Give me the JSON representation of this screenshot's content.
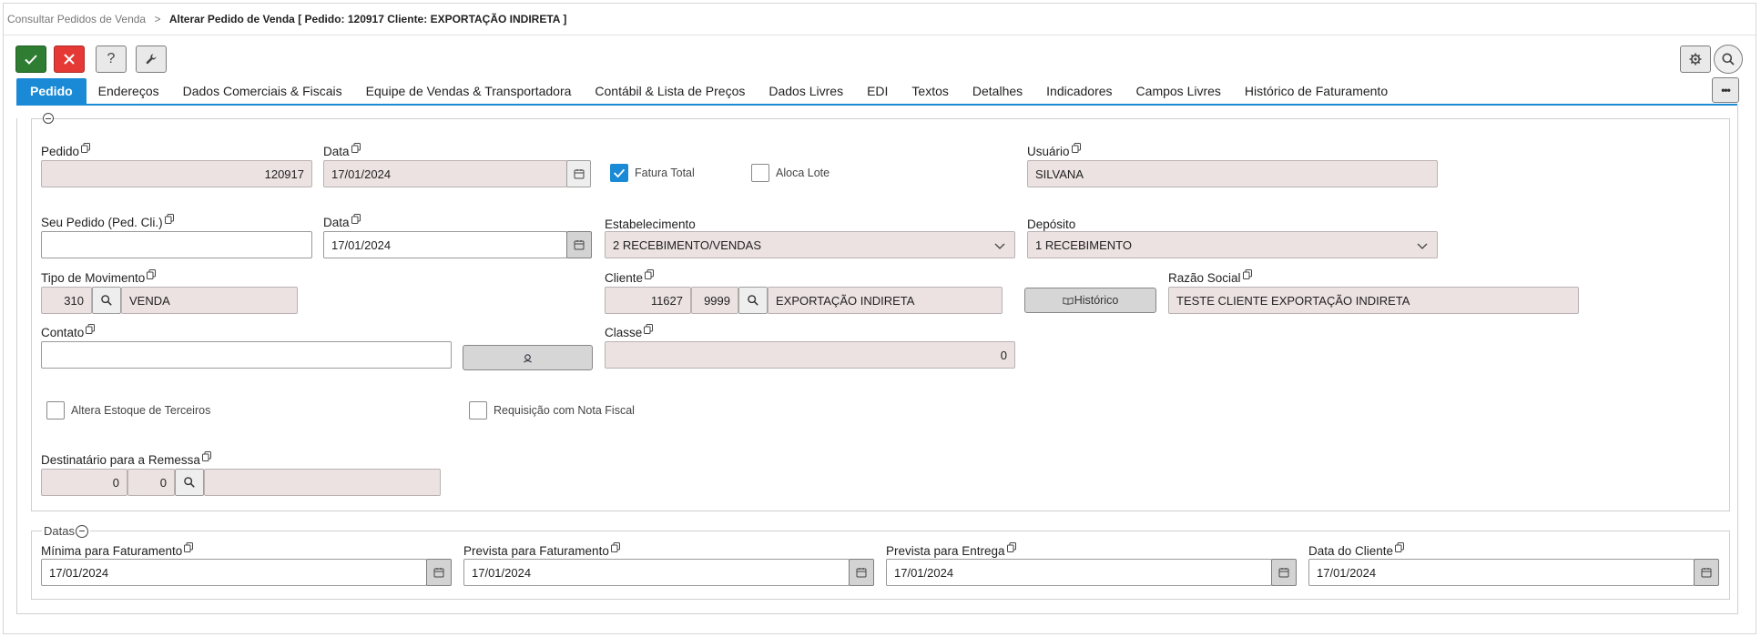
{
  "breadcrumb": {
    "parent": "Consultar Pedidos de Venda",
    "separator": ">",
    "current": "Alterar Pedido de Venda [ Pedido: 120917 Cliente: EXPORTAÇÃO INDIRETA ]"
  },
  "toolbar": {
    "confirm_icon": "check-icon",
    "cancel_icon": "close-icon",
    "help_label": "?",
    "tools_icon": "wrench-icon",
    "settings_icon": "gear-icon",
    "search_icon": "search-icon",
    "more_label": "•••"
  },
  "tabs": [
    "Pedido",
    "Endereços",
    "Dados Comerciais & Fiscais",
    "Equipe de Vendas & Transportadora",
    "Contábil & Lista de Preços",
    "Dados Livres",
    "EDI",
    "Textos",
    "Detalhes",
    "Indicadores",
    "Campos Livres",
    "Histórico de Faturamento"
  ],
  "form": {
    "pedido": {
      "label": "Pedido",
      "value": "120917"
    },
    "data1": {
      "label": "Data",
      "value": "17/01/2024"
    },
    "fatura_total": {
      "label": "Fatura Total",
      "checked": true
    },
    "aloca_lote": {
      "label": "Aloca Lote",
      "checked": false
    },
    "usuario": {
      "label": "Usuário",
      "value": "SILVANA"
    },
    "seu_pedido": {
      "label": "Seu Pedido (Ped. Cli.)",
      "value": ""
    },
    "data2": {
      "label": "Data",
      "value": "17/01/2024"
    },
    "estabelecimento": {
      "label": "Estabelecimento",
      "value": "2 RECEBIMENTO/VENDAS"
    },
    "deposito": {
      "label": "Depósito",
      "value": "1 RECEBIMENTO"
    },
    "tipo_movimento": {
      "label": "Tipo de Movimento",
      "code": "310",
      "desc": "VENDA"
    },
    "cliente": {
      "label": "Cliente",
      "code": "11627",
      "code2": "9999",
      "name": "EXPORTAÇÃO INDIRETA"
    },
    "historico_button": "Histórico",
    "razao_social": {
      "label": "Razão Social",
      "value": "TESTE CLIENTE EXPORTAÇÃO INDIRETA"
    },
    "contato": {
      "label": "Contato",
      "value": ""
    },
    "classe": {
      "label": "Classe",
      "value": "0"
    },
    "altera_estoque": {
      "label": "Altera Estoque de Terceiros",
      "checked": false
    },
    "requisicao_nf": {
      "label": "Requisição com Nota Fiscal",
      "checked": false
    },
    "destinatario": {
      "label": "Destinatário para a Remessa",
      "code1": "0",
      "code2": "0",
      "desc": ""
    }
  },
  "datas": {
    "legend": "Datas",
    "minima": {
      "label": "Mínima para Faturamento",
      "value": "17/01/2024"
    },
    "prevista_fat": {
      "label": "Prevista para Faturamento",
      "value": "17/01/2024"
    },
    "prevista_ent": {
      "label": "Prevista para Entrega",
      "value": "17/01/2024"
    },
    "data_cliente": {
      "label": "Data do Cliente",
      "value": "17/01/2024"
    }
  }
}
